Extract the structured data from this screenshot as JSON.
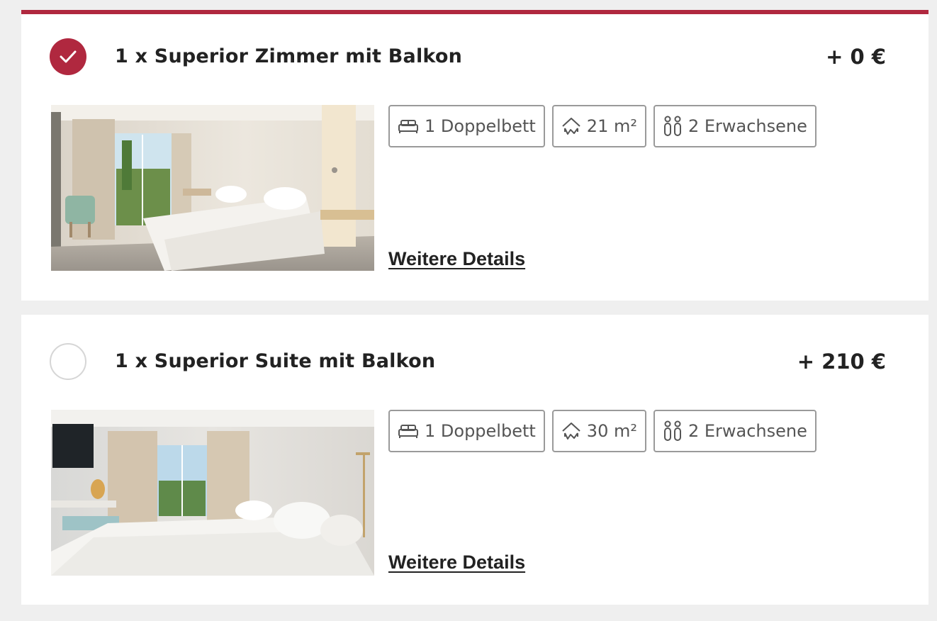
{
  "accent_color": "#b0283f",
  "rooms": [
    {
      "selected": true,
      "title": "1 x Superior Zimmer mit Balkon",
      "price": "+ 0 €",
      "features": {
        "bed": "1 Doppelbett",
        "size": "21 m²",
        "guests": "2 Erwachsene"
      },
      "details_label": "Weitere Details"
    },
    {
      "selected": false,
      "title": "1 x Superior Suite mit Balkon",
      "price": "+ 210 €",
      "features": {
        "bed": "1 Doppelbett",
        "size": "30 m²",
        "guests": "2 Erwachsene"
      },
      "details_label": "Weitere Details"
    }
  ],
  "icons": [
    "check-icon",
    "bed-icon",
    "room-size-icon",
    "guests-icon"
  ]
}
